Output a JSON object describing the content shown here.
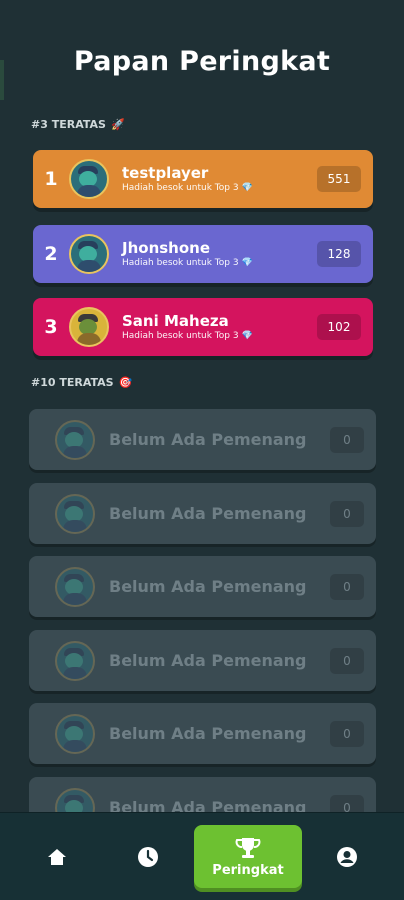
{
  "header": {
    "title": "Papan Peringkat"
  },
  "sections": {
    "top3_label": "#3 TERATAS",
    "top10_label": "#10 TERATAS"
  },
  "top3": [
    {
      "rank": "1",
      "name": "testplayer",
      "subtitle": "Hadiah besok untuk Top 3",
      "score": "551",
      "color": "#e08a34"
    },
    {
      "rank": "2",
      "name": "Jhonshone",
      "subtitle": "Hadiah besok untuk Top 3",
      "score": "128",
      "color": "#6a67d0"
    },
    {
      "rank": "3",
      "name": "Sani Maheza",
      "subtitle": "Hadiah besok untuk Top 3",
      "score": "102",
      "color": "#d4145e"
    }
  ],
  "top10": [
    {
      "name": "Belum Ada Pemenang",
      "score": "0"
    },
    {
      "name": "Belum Ada Pemenang",
      "score": "0"
    },
    {
      "name": "Belum Ada Pemenang",
      "score": "0"
    },
    {
      "name": "Belum Ada Pemenang",
      "score": "0"
    },
    {
      "name": "Belum Ada Pemenang",
      "score": "0"
    },
    {
      "name": "Belum Ada Pemenang",
      "score": "0"
    }
  ],
  "nav": {
    "active_label": "Peringkat",
    "items": [
      "home-icon",
      "clock-icon",
      "trophy-icon",
      "profile-icon"
    ]
  },
  "colors": {
    "background": "#1f3035",
    "nav_active": "#6dc131"
  }
}
